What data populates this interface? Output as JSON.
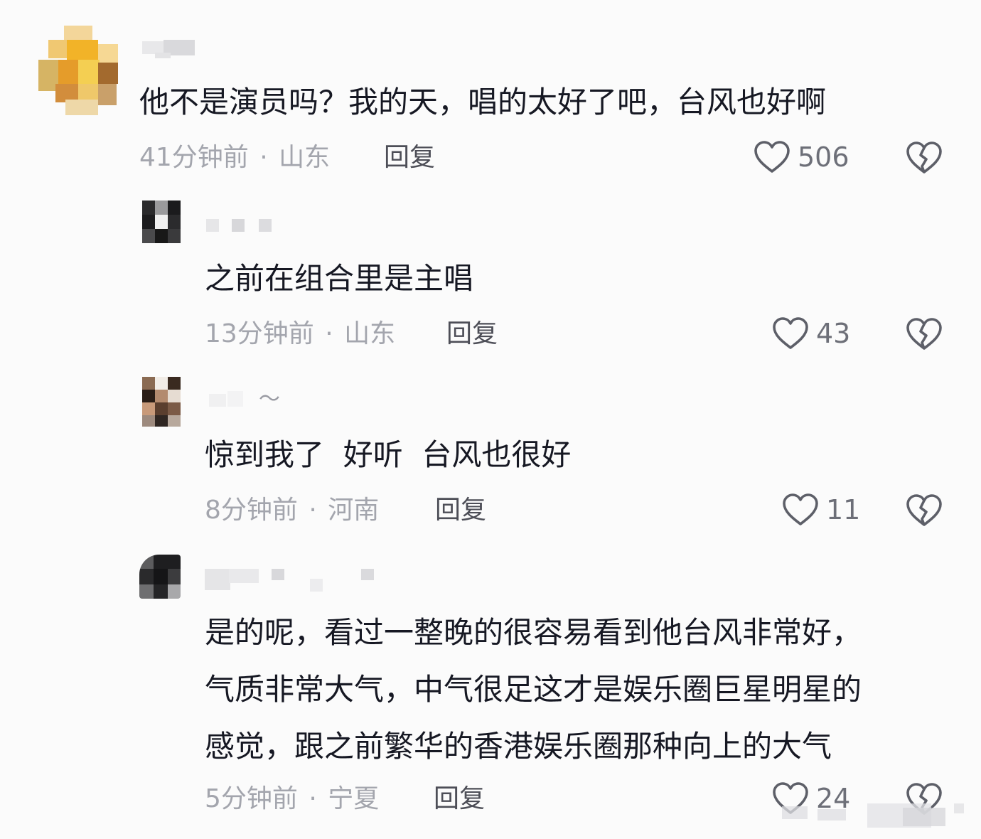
{
  "comments": [
    {
      "text": "他不是演员吗？我的天，唱的太好了吧，台风也好啊",
      "time": "41分钟前",
      "sep": "·",
      "location": "山东",
      "reply_label": "回复",
      "likes": "506"
    },
    {
      "text": "之前在组合里是主唱",
      "time": "13分钟前",
      "sep": "·",
      "location": "山东",
      "reply_label": "回复",
      "likes": "43"
    },
    {
      "username_tail": "～",
      "text": "惊到我了  好听  台风也很好",
      "time": "8分钟前",
      "sep": "·",
      "location": "河南",
      "reply_label": "回复",
      "likes": "11"
    },
    {
      "text_lines": [
        "是的呢，看过一整晚的很容易看到他台风非常好，",
        "气质非常大气，中气很足这才是娱乐圈巨星明星的",
        "感觉，跟之前繁华的香港娱乐圈那种向上的大气"
      ],
      "time": "5分钟前",
      "sep": "·",
      "location": "宁夏",
      "reply_label": "回复",
      "likes": "24"
    }
  ],
  "icons": {
    "like": "heart-outline-icon",
    "dislike": "broken-heart-icon"
  },
  "colors": {
    "text": "#161823",
    "meta": "#a3a5ad",
    "reply": "#4d4e57",
    "icon": "#5d5f68"
  }
}
